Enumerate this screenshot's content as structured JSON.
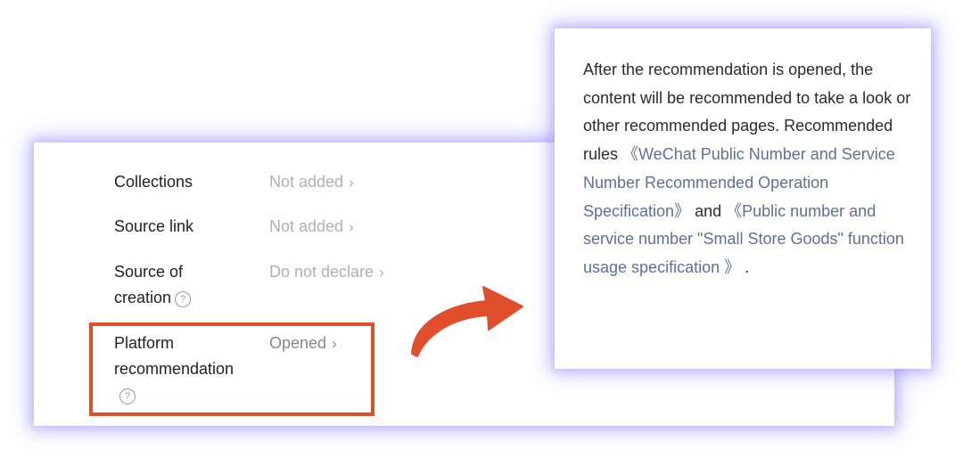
{
  "settings": {
    "rows": [
      {
        "label": "Collections",
        "value": "Not added"
      },
      {
        "label": "Source link",
        "value": "Not added"
      },
      {
        "label_line1": "Source of",
        "label_line2": "creation",
        "value": "Do not declare"
      },
      {
        "label_line1": "Platform",
        "label_line2": "recommendation",
        "value": "Opened"
      }
    ],
    "help_glyph": "?",
    "chevron_glyph": "›"
  },
  "tooltip": {
    "text_before": "After the recommendation is opened, the content will be recommended to take a look or other recommended pages. Recommended rules ",
    "link1": "《WeChat Public Number and Service Number Recommended Operation Specification》",
    "middle": " and ",
    "link2": "《Public number and service number \"Small Store Goods\" function usage specification 》",
    "text_after": " ."
  },
  "colors": {
    "highlight_border": "#e04e2c",
    "arrow": "#e04e2c",
    "link": "#5f6f96",
    "panel_glow": "#8c82f5"
  },
  "icons": [
    "help-circle-icon",
    "chevron-right-icon",
    "curved-arrow-icon"
  ]
}
